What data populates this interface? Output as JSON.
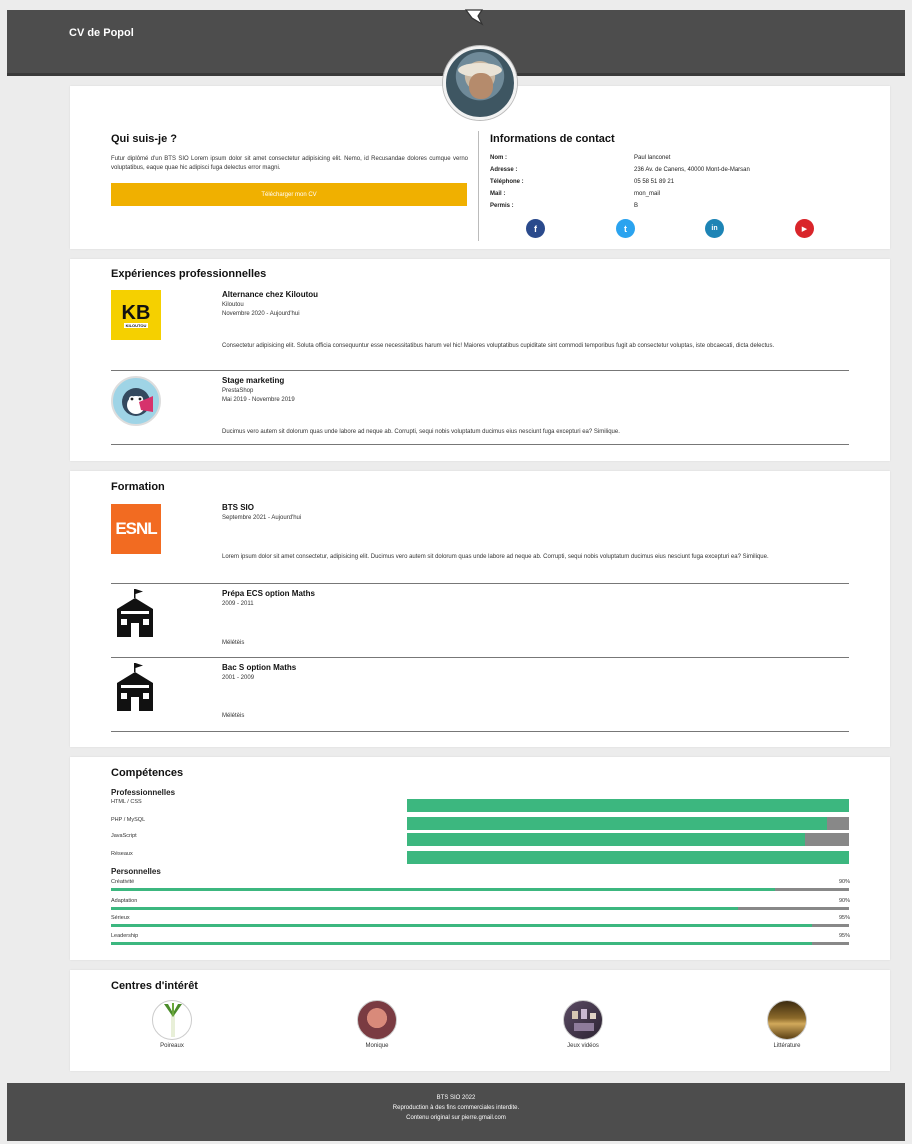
{
  "header": {
    "title": "CV de Popol"
  },
  "about": {
    "heading": "Qui suis-je ?",
    "text": "Futur diplômé d'un BTS SIO Lorem ipsum dolor sit amet consectetur adipisicing elit. Nemo, id Recusandae dolores cumque verno voluptatibus, eaque quae hic adipisci fuga delectus error magni.",
    "download_label": "Télécharger mon CV"
  },
  "contact": {
    "heading": "Informations de contact",
    "rows": [
      {
        "label": "Nom :",
        "value": "Paul lanconet"
      },
      {
        "label": "Adresse :",
        "value": "236 Av. de Canens, 40000 Mont-de-Marsan"
      },
      {
        "label": "Téléphone :",
        "value": "05 58 51 89 21"
      },
      {
        "label": "Mail :",
        "value": "mon_mail"
      },
      {
        "label": "Permis :",
        "value": "B"
      }
    ],
    "socials": [
      {
        "icon": "facebook-icon",
        "glyph": "f",
        "color": "#2a4a8c"
      },
      {
        "icon": "twitter-icon",
        "glyph": "t",
        "color": "#2aa3ef"
      },
      {
        "icon": "linkedin-icon",
        "glyph": "in",
        "color": "#1d84b5"
      },
      {
        "icon": "youtube-icon",
        "glyph": "▶",
        "color": "#d9252a"
      }
    ]
  },
  "experiences": {
    "heading": "Expériences professionnelles",
    "items": [
      {
        "logo_text": "KB",
        "logo_sub": "KILOUTOU",
        "title": "Alternance chez Kiloutou",
        "company": "Kiloutou",
        "dates": "Novembre 2020 - Aujourd'hui",
        "desc": "Consectetur adipisicing elit. Soluta officia consequuntur esse necessitatibus harum vel hic! Maiores voluptatibus cupiditate sint commodi temporibus fugit ab consectetur voluptas, iste obcaecati, dicta delectus."
      },
      {
        "title": "Stage marketing",
        "company": "PrestaShop",
        "dates": "Mai 2019 - Novembre 2019",
        "desc": "Ducimus vero autem sit dolorum quas unde labore ad neque ab. Corrupti, sequi nobis voluptatum ducimus eius nesciunt fuga excepturi ea? Similique."
      }
    ]
  },
  "formation": {
    "heading": "Formation",
    "items": [
      {
        "logo_text": "ESNL",
        "title": "BTS SIO",
        "dates": "Septembre 2021 - Aujourd'hui",
        "desc": "Lorem ipsum dolor sit amet consectetur, adipisicing elit. Ducimus vero autem sit dolorum quas unde labore ad neque ab. Corrupti, sequi nobis voluptatum ducimus eius nesciunt fuga excepturi ea? Similique."
      },
      {
        "title": "Prépa ECS option Maths",
        "dates": "2009 - 2011",
        "desc": "Mélétèis"
      },
      {
        "title": "Bac S option Maths",
        "dates": "2001 - 2009",
        "desc": "Mélétèis"
      }
    ]
  },
  "skills": {
    "heading": "Compétences",
    "pro_heading": "Professionnelles",
    "pro": [
      {
        "name": "HTML / CSS",
        "level": 100
      },
      {
        "name": "PHP / MySQL",
        "level": 95
      },
      {
        "name": "JavaScript",
        "level": 90
      },
      {
        "name": "Réseaux",
        "level": 100
      }
    ],
    "perso_heading": "Personnelles",
    "perso": [
      {
        "name": "Créativité",
        "pct": "90%",
        "level": 90
      },
      {
        "name": "Adaptation",
        "pct": "90%",
        "level": 85
      },
      {
        "name": "Sérieux",
        "pct": "95%",
        "level": 95
      },
      {
        "name": "Leadership",
        "pct": "95%",
        "level": 95
      }
    ]
  },
  "interests": {
    "heading": "Centres d'intérêt",
    "items": [
      {
        "caption": "Poireaux"
      },
      {
        "caption": "Monique"
      },
      {
        "caption": "Jeux vidéos"
      },
      {
        "caption": "Littérature"
      }
    ]
  },
  "footer": {
    "line1": "BTS SIO 2022",
    "line2": "Reproduction à des fins commerciales interdite.",
    "line3": "Contenu original sur pierre.gmail.com"
  }
}
